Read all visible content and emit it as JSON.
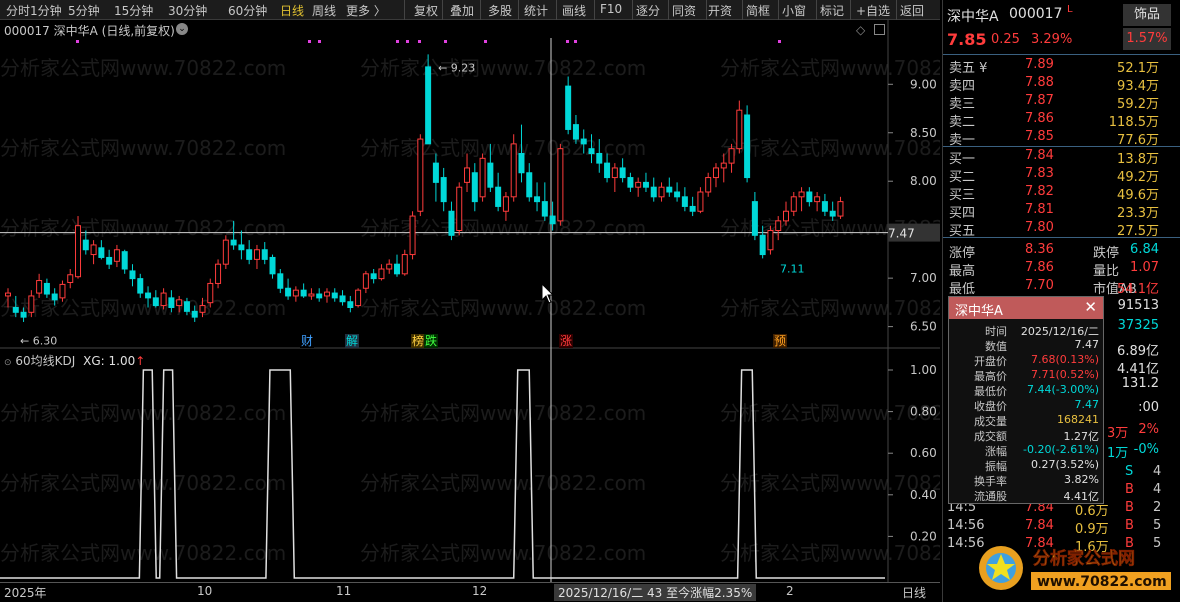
{
  "toolbar": {
    "items": [
      "分时",
      "1分钟",
      "5分钟",
      "15分钟",
      "30分钟",
      "60分钟",
      "日线",
      "周线",
      "更多 〉",
      "复权",
      "叠加",
      "多股",
      "统计",
      "画线",
      "F10",
      "逐分",
      "同资",
      "开资",
      "简框",
      "小窗",
      "标记",
      "+自选",
      "返回"
    ],
    "active": "日线"
  },
  "chart": {
    "title": "000017 深中华A (日线,前复权)",
    "price_ticks": [
      "9.00",
      "8.50",
      "8.00",
      "7.00",
      "6.50"
    ],
    "crosshair_price": "7.47",
    "high_label": "9.23",
    "low_label": "6.30",
    "low2_label": "7.11",
    "event_labels": [
      "财",
      "解",
      "榜",
      "跌",
      "涨",
      "预"
    ],
    "indicator_title": "60均线KDJ",
    "indicator_value": "XG: 1.00",
    "indicator_ticks": [
      "1.00",
      "0.80",
      "0.60",
      "0.40",
      "0.20"
    ],
    "xaxis_labels": [
      "2025年",
      "10",
      "11",
      "12",
      "2"
    ],
    "xaxis_cursor": "2025/12/16/二 43 至今涨幅2.35%",
    "period_label": "日线"
  },
  "chart_data": {
    "type": "candlestick",
    "ylim": [
      6.2,
      9.4
    ],
    "candles": [
      [
        6.72,
        6.8,
        6.6,
        6.75
      ],
      [
        6.6,
        6.72,
        6.5,
        6.55
      ],
      [
        6.55,
        6.6,
        6.45,
        6.5
      ],
      [
        6.55,
        6.78,
        6.5,
        6.72
      ],
      [
        6.75,
        6.95,
        6.7,
        6.88
      ],
      [
        6.85,
        6.9,
        6.7,
        6.74
      ],
      [
        6.74,
        6.8,
        6.62,
        6.68
      ],
      [
        6.7,
        6.88,
        6.66,
        6.84
      ],
      [
        6.86,
        7.0,
        6.8,
        6.94
      ],
      [
        6.92,
        7.55,
        6.9,
        7.45
      ],
      [
        7.3,
        7.4,
        7.15,
        7.2
      ],
      [
        7.15,
        7.3,
        7.05,
        7.25
      ],
      [
        7.22,
        7.3,
        7.1,
        7.12
      ],
      [
        7.12,
        7.2,
        7.0,
        7.05
      ],
      [
        7.08,
        7.25,
        7.02,
        7.2
      ],
      [
        7.18,
        7.2,
        6.95,
        7.0
      ],
      [
        6.98,
        7.05,
        6.82,
        6.9
      ],
      [
        6.9,
        6.95,
        6.7,
        6.75
      ],
      [
        6.75,
        6.82,
        6.6,
        6.7
      ],
      [
        6.7,
        6.78,
        6.6,
        6.62
      ],
      [
        6.62,
        6.8,
        6.58,
        6.75
      ],
      [
        6.7,
        6.78,
        6.55,
        6.6
      ],
      [
        6.62,
        6.72,
        6.55,
        6.68
      ],
      [
        6.66,
        6.7,
        6.52,
        6.56
      ],
      [
        6.56,
        6.62,
        6.45,
        6.5
      ],
      [
        6.55,
        6.7,
        6.5,
        6.62
      ],
      [
        6.65,
        6.9,
        6.6,
        6.85
      ],
      [
        6.85,
        7.1,
        6.8,
        7.05
      ],
      [
        7.05,
        7.35,
        7.0,
        7.3
      ],
      [
        7.3,
        7.5,
        7.2,
        7.25
      ],
      [
        7.25,
        7.4,
        7.1,
        7.2
      ],
      [
        7.2,
        7.3,
        7.05,
        7.1
      ],
      [
        7.1,
        7.25,
        7.0,
        7.2
      ],
      [
        7.2,
        7.28,
        7.05,
        7.1
      ],
      [
        7.12,
        7.15,
        6.9,
        6.95
      ],
      [
        6.95,
        7.0,
        6.75,
        6.8
      ],
      [
        6.8,
        6.9,
        6.68,
        6.72
      ],
      [
        6.72,
        6.82,
        6.66,
        6.78
      ],
      [
        6.78,
        6.85,
        6.7,
        6.72
      ],
      [
        6.72,
        6.8,
        6.68,
        6.74
      ],
      [
        6.74,
        6.8,
        6.66,
        6.7
      ],
      [
        6.72,
        6.8,
        6.65,
        6.76
      ],
      [
        6.75,
        6.8,
        6.66,
        6.7
      ],
      [
        6.72,
        6.78,
        6.62,
        6.66
      ],
      [
        6.66,
        6.72,
        6.55,
        6.6
      ],
      [
        6.62,
        6.8,
        6.6,
        6.78
      ],
      [
        6.8,
        6.98,
        6.75,
        6.95
      ],
      [
        6.95,
        7.0,
        6.85,
        6.9
      ],
      [
        6.9,
        7.05,
        6.88,
        7.0
      ],
      [
        7.0,
        7.1,
        6.95,
        7.05
      ],
      [
        7.05,
        7.15,
        6.92,
        6.95
      ],
      [
        6.95,
        7.2,
        6.93,
        7.15
      ],
      [
        7.15,
        7.6,
        7.1,
        7.55
      ],
      [
        7.6,
        8.4,
        7.55,
        8.35
      ],
      [
        9.1,
        9.23,
        8.3,
        8.3
      ],
      [
        8.1,
        8.2,
        7.7,
        7.9
      ],
      [
        7.95,
        8.05,
        7.6,
        7.7
      ],
      [
        7.6,
        7.7,
        7.3,
        7.35
      ],
      [
        7.4,
        7.9,
        7.35,
        7.85
      ],
      [
        7.9,
        8.2,
        7.8,
        8.05
      ],
      [
        8.0,
        8.1,
        7.6,
        7.7
      ],
      [
        7.75,
        8.2,
        7.7,
        8.15
      ],
      [
        8.1,
        8.3,
        7.8,
        7.85
      ],
      [
        7.85,
        8.0,
        7.6,
        7.65
      ],
      [
        7.6,
        7.8,
        7.5,
        7.75
      ],
      [
        7.75,
        8.4,
        7.7,
        8.3
      ],
      [
        8.2,
        8.5,
        7.9,
        8.0
      ],
      [
        8.0,
        8.1,
        7.7,
        7.75
      ],
      [
        7.75,
        7.9,
        7.6,
        7.7
      ],
      [
        7.7,
        7.9,
        7.5,
        7.55
      ],
      [
        7.55,
        7.7,
        7.4,
        7.47
      ],
      [
        7.5,
        8.3,
        7.45,
        8.25
      ],
      [
        8.9,
        9.0,
        8.4,
        8.45
      ],
      [
        8.5,
        8.6,
        8.3,
        8.35
      ],
      [
        8.35,
        8.45,
        8.2,
        8.3
      ],
      [
        8.25,
        8.4,
        8.1,
        8.2
      ],
      [
        8.2,
        8.35,
        8.0,
        8.1
      ],
      [
        8.1,
        8.2,
        7.9,
        7.95
      ],
      [
        7.95,
        8.1,
        7.8,
        8.05
      ],
      [
        8.05,
        8.15,
        7.9,
        7.95
      ],
      [
        7.95,
        8.0,
        7.8,
        7.85
      ],
      [
        7.85,
        7.95,
        7.75,
        7.9
      ],
      [
        7.9,
        8.0,
        7.8,
        7.85
      ],
      [
        7.85,
        7.95,
        7.7,
        7.75
      ],
      [
        7.75,
        7.9,
        7.7,
        7.85
      ],
      [
        7.85,
        7.95,
        7.75,
        7.8
      ],
      [
        7.8,
        7.9,
        7.7,
        7.75
      ],
      [
        7.75,
        7.85,
        7.6,
        7.65
      ],
      [
        7.65,
        7.75,
        7.55,
        7.6
      ],
      [
        7.6,
        7.85,
        7.58,
        7.8
      ],
      [
        7.8,
        8.0,
        7.75,
        7.95
      ],
      [
        7.95,
        8.1,
        7.85,
        8.05
      ],
      [
        8.05,
        8.2,
        7.9,
        8.1
      ],
      [
        8.1,
        8.3,
        8.0,
        8.25
      ],
      [
        8.25,
        8.75,
        8.2,
        8.65
      ],
      [
        8.6,
        8.7,
        7.9,
        7.95
      ],
      [
        7.7,
        7.8,
        7.3,
        7.35
      ],
      [
        7.35,
        7.45,
        7.11,
        7.15
      ],
      [
        7.2,
        7.45,
        7.15,
        7.4
      ],
      [
        7.4,
        7.55,
        7.3,
        7.5
      ],
      [
        7.5,
        7.7,
        7.45,
        7.6
      ],
      [
        7.6,
        7.8,
        7.55,
        7.75
      ],
      [
        7.75,
        7.85,
        7.6,
        7.8
      ],
      [
        7.8,
        7.85,
        7.65,
        7.7
      ],
      [
        7.7,
        7.8,
        7.6,
        7.75
      ],
      [
        7.7,
        7.78,
        7.55,
        7.6
      ],
      [
        7.6,
        7.7,
        7.5,
        7.55
      ],
      [
        7.55,
        7.75,
        7.52,
        7.7
      ]
    ],
    "kdj_spikes": [
      [
        0.162,
        0.172
      ],
      [
        0.185,
        0.195
      ],
      [
        0.305,
        0.328
      ],
      [
        0.585,
        0.598
      ],
      [
        0.838,
        0.85
      ]
    ]
  },
  "quote": {
    "name": "深中华A",
    "code": "000017",
    "flag": "L",
    "tag": "饰品",
    "price": "7.85",
    "change": "0.25",
    "change_pct": "3.29%",
    "tag_pct": "1.57%",
    "asks": [
      {
        "label": "卖五 ¥",
        "price": "7.89",
        "vol": "52.1万"
      },
      {
        "label": "卖四",
        "price": "7.88",
        "vol": "93.4万"
      },
      {
        "label": "卖三",
        "price": "7.87",
        "vol": "59.2万"
      },
      {
        "label": "卖二",
        "price": "7.86",
        "vol": "118.5万"
      },
      {
        "label": "卖一",
        "price": "7.85",
        "vol": "77.6万"
      }
    ],
    "bids": [
      {
        "label": "买一",
        "price": "7.84",
        "vol": "13.8万"
      },
      {
        "label": "买二",
        "price": "7.83",
        "vol": "49.2万"
      },
      {
        "label": "买三",
        "price": "7.82",
        "vol": "49.6万"
      },
      {
        "label": "买四",
        "price": "7.81",
        "vol": "23.3万"
      },
      {
        "label": "买五",
        "price": "7.80",
        "vol": "27.5万"
      }
    ],
    "stats": [
      {
        "l1": "涨停",
        "v1": "8.36",
        "l2": "跌停",
        "v2": "6.84"
      },
      {
        "l1": "最高",
        "v1": "7.86",
        "l2": "量比",
        "v2": "1.07"
      },
      {
        "l1": "最低",
        "v1": "7.70",
        "l2": "市值AB",
        "v2": "54.1亿"
      }
    ],
    "partial_right": [
      "91513",
      "37325",
      "6.89亿",
      "4.41亿",
      "131.2",
      ":00"
    ],
    "partial_row": {
      "a": "3万",
      "b": "2%"
    },
    "partial_row2": {
      "a": "1万",
      "b": "-0%"
    },
    "ticks": [
      {
        "t": "",
        "p": "",
        "v": "万",
        "s": "S",
        "n": "4"
      },
      {
        "t": "",
        "p": "",
        "v": "万",
        "s": "B",
        "n": "4"
      },
      {
        "t": "14:5",
        "p": "7.84",
        "v": "0.6万",
        "s": "B",
        "n": "2"
      },
      {
        "t": "14:56",
        "p": "7.84",
        "v": "0.9万",
        "s": "B",
        "n": "5"
      },
      {
        "t": "14:56",
        "p": "7.84",
        "v": "1.6万",
        "s": "B",
        "n": "5"
      }
    ]
  },
  "popup": {
    "title": "深中华A",
    "rows": [
      {
        "l": "时间",
        "v": "2025/12/16/二",
        "c": "#e0e0e0"
      },
      {
        "l": "数值",
        "v": "7.47",
        "c": "#e0e0e0"
      },
      {
        "l": "开盘价",
        "v": "7.68(0.13%)",
        "c": "#ff3c3c"
      },
      {
        "l": "最高价",
        "v": "7.71(0.52%)",
        "c": "#ff3c3c"
      },
      {
        "l": "最低价",
        "v": "7.44(-3.00%)",
        "c": "#00d8d8"
      },
      {
        "l": "收盘价",
        "v": "7.47",
        "c": "#00d8d8"
      },
      {
        "l": "成交量",
        "v": "168241",
        "c": "#e8c040"
      },
      {
        "l": "成交额",
        "v": "1.27亿",
        "c": "#e0e0e0"
      },
      {
        "l": "涨幅",
        "v": "-0.20(-2.61%)",
        "c": "#00d8d8"
      },
      {
        "l": "振幅",
        "v": "0.27(3.52%)",
        "c": "#e0e0e0"
      },
      {
        "l": "换手率",
        "v": "3.82%",
        "c": "#e0e0e0"
      },
      {
        "l": "流通股",
        "v": "4.41亿",
        "c": "#e0e0e0"
      }
    ]
  },
  "logo": {
    "line1": "分析家公式网",
    "line2": "www.70822.com"
  },
  "watermark": "分析家公式网www.70822.com"
}
